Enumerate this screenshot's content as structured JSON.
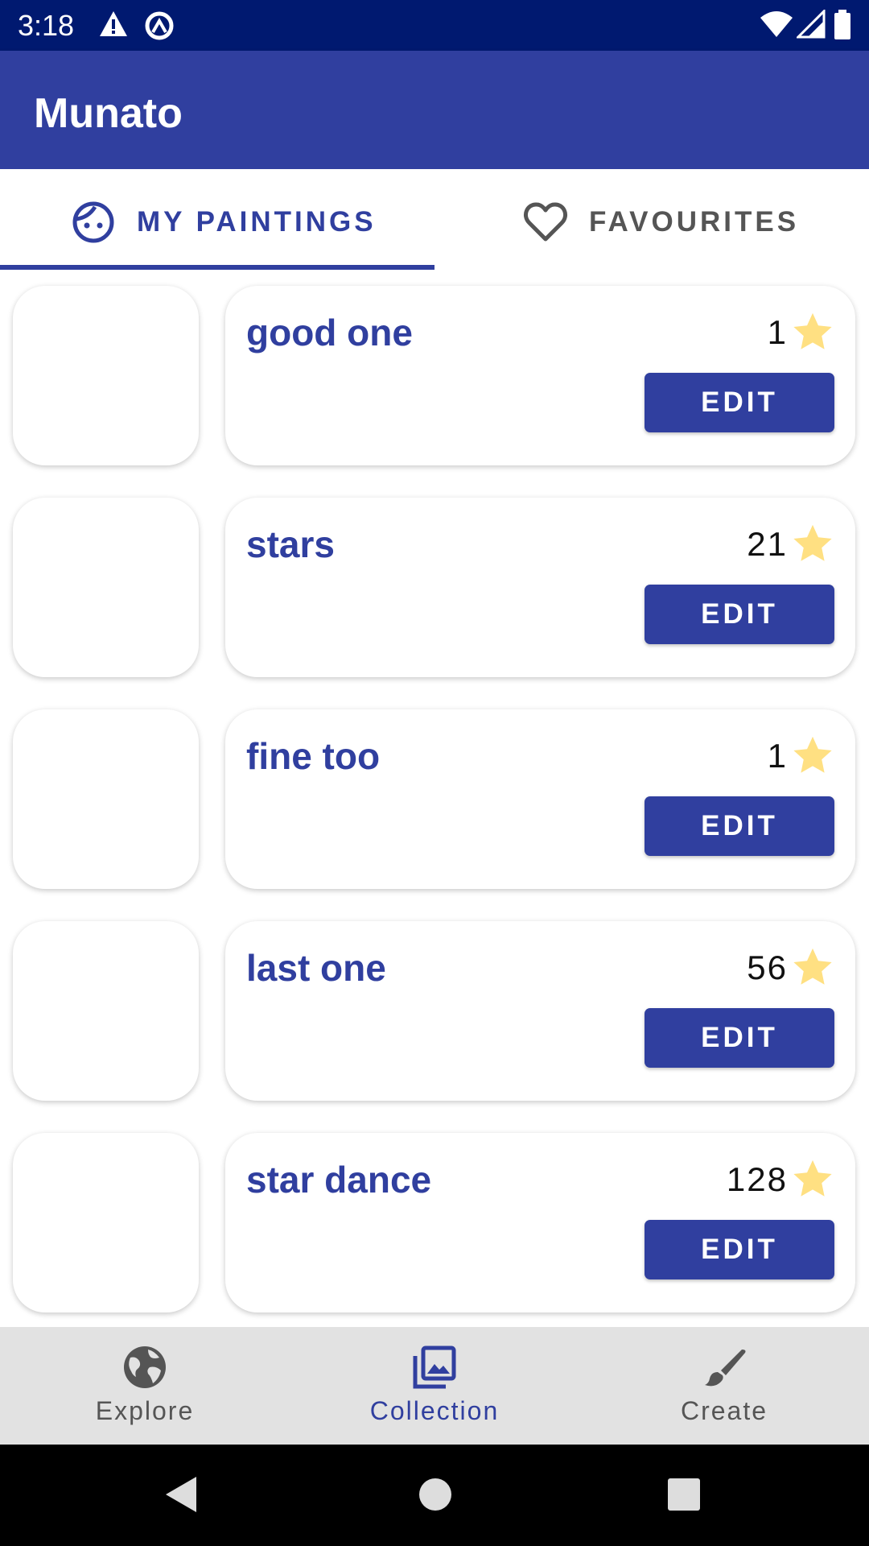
{
  "status_bar": {
    "time": "3:18"
  },
  "app": {
    "title": "Munato"
  },
  "tabs": [
    {
      "label": "MY PAINTINGS",
      "icon": "face-icon",
      "selected": true
    },
    {
      "label": "FAVOURITES",
      "icon": "heart-outline-icon",
      "selected": false
    }
  ],
  "paintings": [
    {
      "title": "good one",
      "stars": "1",
      "edit_label": "EDIT"
    },
    {
      "title": "stars",
      "stars": "21",
      "edit_label": "EDIT"
    },
    {
      "title": "fine too",
      "stars": "1",
      "edit_label": "EDIT"
    },
    {
      "title": "last one",
      "stars": "56",
      "edit_label": "EDIT"
    },
    {
      "title": "star dance",
      "stars": "128",
      "edit_label": "EDIT"
    }
  ],
  "bottom_nav": [
    {
      "label": "Explore",
      "icon": "globe-icon",
      "selected": false
    },
    {
      "label": "Collection",
      "icon": "photo-library-icon",
      "selected": true
    },
    {
      "label": "Create",
      "icon": "brush-icon",
      "selected": false
    }
  ],
  "colors": {
    "primary": "#303f9f",
    "primary_dark": "#001970",
    "star": "#ffe082",
    "nav_background": "#e2e2e2",
    "inactive_text": "#555555"
  }
}
